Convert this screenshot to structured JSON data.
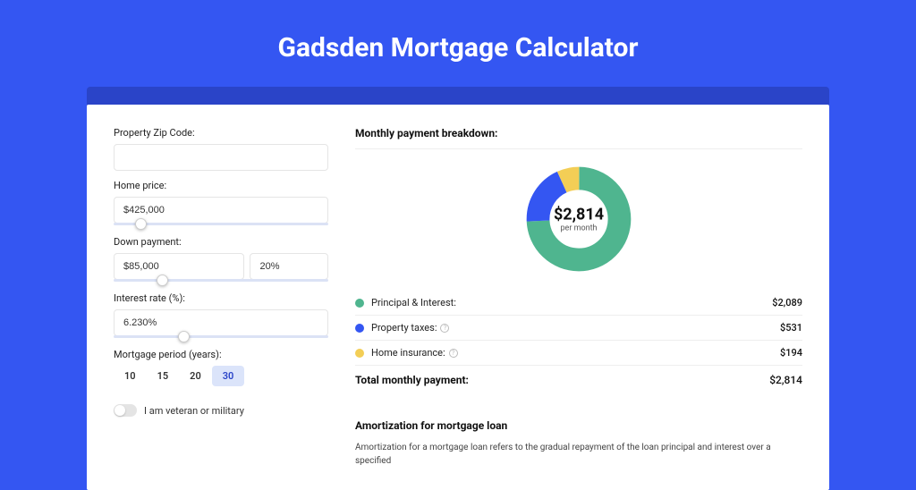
{
  "title": "Gadsden Mortgage Calculator",
  "form": {
    "zip_label": "Property Zip Code:",
    "zip_value": "",
    "home_price_label": "Home price:",
    "home_price": "$425,000",
    "down_payment_label": "Down payment:",
    "down_payment_amount": "$85,000",
    "down_payment_percent": "20%",
    "rate_label": "Interest rate (%):",
    "rate": "6.230%",
    "period_label": "Mortgage period (years):",
    "period_options": [
      "10",
      "15",
      "20",
      "30"
    ],
    "period_selected": "30",
    "veteran_label": "I am veteran or military"
  },
  "breakdown": {
    "title": "Monthly payment breakdown:",
    "center_amount": "$2,814",
    "center_sub": "per month",
    "items": [
      {
        "label": "Principal & Interest:",
        "value": "$2,089",
        "color": "#4fb58f",
        "info": false
      },
      {
        "label": "Property taxes:",
        "value": "$531",
        "color": "#3456f2",
        "info": true
      },
      {
        "label": "Home insurance:",
        "value": "$194",
        "color": "#f3ce56",
        "info": true
      }
    ],
    "total_label": "Total monthly payment:",
    "total_value": "$2,814"
  },
  "amortization": {
    "title": "Amortization for mortgage loan",
    "text": "Amortization for a mortgage loan refers to the gradual repayment of the loan principal and interest over a specified"
  },
  "chart_data": {
    "type": "pie",
    "title": "Monthly payment breakdown",
    "series": [
      {
        "name": "Principal & Interest",
        "value": 2089,
        "color": "#4fb58f"
      },
      {
        "name": "Property taxes",
        "value": 531,
        "color": "#3456f2"
      },
      {
        "name": "Home insurance",
        "value": 194,
        "color": "#f3ce56"
      }
    ],
    "total": 2814,
    "center_label": "$2,814 per month"
  }
}
